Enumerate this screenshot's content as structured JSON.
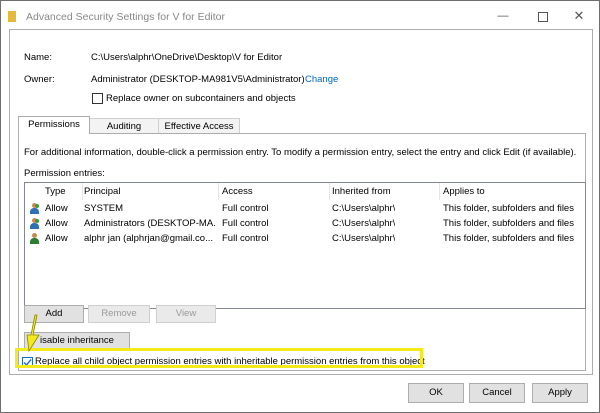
{
  "window": {
    "title": "Advanced Security Settings for V for Editor",
    "minimize": "—",
    "close": "✕"
  },
  "name": {
    "label": "Name:",
    "value": "C:\\Users\\alphr\\OneDrive\\Desktop\\V for Editor"
  },
  "owner": {
    "label": "Owner:",
    "value": "Administrator (DESKTOP-MA981V5\\Administrator)",
    "change_link": "Change"
  },
  "replace_owner": {
    "label": "Replace owner on subcontainers and objects",
    "checked": false
  },
  "tabs": [
    {
      "label": "Permissions",
      "active": true
    },
    {
      "label": "Auditing",
      "active": false
    },
    {
      "label": "Effective Access",
      "active": false
    }
  ],
  "info_text": "For additional information, double-click a permission entry. To modify a permission entry, select the entry and click Edit (if available).",
  "entries_label": "Permission entries:",
  "columns": [
    "Type",
    "Principal",
    "Access",
    "Inherited from",
    "Applies to"
  ],
  "rows": [
    {
      "icon": "group-icon",
      "type": "Allow",
      "principal": "SYSTEM",
      "access": "Full control",
      "inherited": "C:\\Users\\alphr\\",
      "applies": "This folder, subfolders and files"
    },
    {
      "icon": "group-icon",
      "type": "Allow",
      "principal": "Administrators (DESKTOP-MA...",
      "access": "Full control",
      "inherited": "C:\\Users\\alphr\\",
      "applies": "This folder, subfolders and files"
    },
    {
      "icon": "user-icon",
      "type": "Allow",
      "principal": "alphr jan (alphrjan@gmail.co...",
      "access": "Full control",
      "inherited": "C:\\Users\\alphr\\",
      "applies": "This folder, subfolders and files"
    }
  ],
  "buttons": {
    "add": "Add",
    "remove": "Remove",
    "view": "View",
    "disable_inheritance": "isable inheritance"
  },
  "replace_child": {
    "label": "Replace all child object permission entries with inheritable permission entries from this object",
    "checked": true
  },
  "footer": {
    "ok": "OK",
    "cancel": "Cancel",
    "apply": "Apply"
  },
  "colors": {
    "highlight": "#f2ea1b",
    "link": "#0066cc",
    "arrow": "#f2ea1b"
  }
}
